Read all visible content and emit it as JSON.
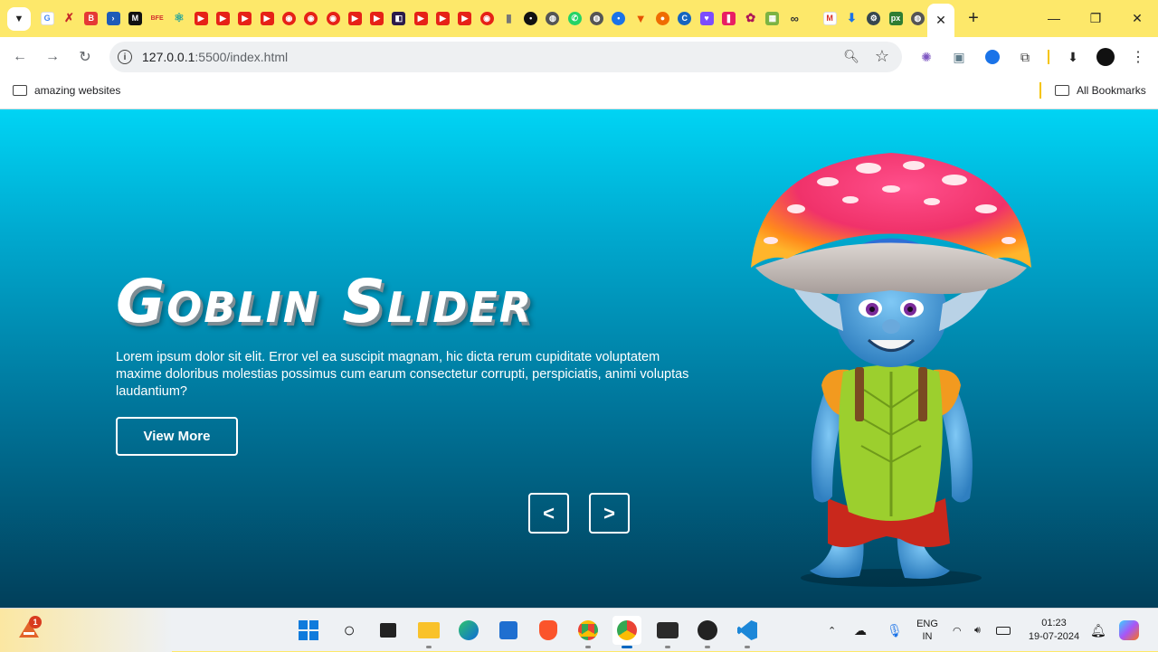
{
  "browser": {
    "url_host": "127.0.0.1",
    "url_path": ":5500/index.html",
    "close_tab": "✕",
    "new_tab": "+",
    "bookmarks": {
      "folder1": "amazing websites",
      "all": "All Bookmarks"
    },
    "pinned_labels": {
      "mono": "M",
      "bfe": "BFE",
      "px": "px"
    }
  },
  "hero": {
    "title": "Goblin Slider",
    "description": "Lorem ipsum dolor sit elit. Error vel ea suscipit magnam, hic dicta rerum cupiditate voluptatem maxime doloribus molestias possimus cum earum consectetur corrupti, perspiciatis, animi voluptas laudantium?",
    "cta_label": "View More",
    "prev_label": "<",
    "next_label": ">"
  },
  "taskbar": {
    "weather_badge": "1",
    "lang_line1": "ENG",
    "lang_line2": "IN",
    "time": "01:23",
    "date": "19-07-2024"
  },
  "colors": {
    "tab_strip": "#fde86a",
    "hero_gradient_top": "#00d4f4",
    "hero_gradient_bottom": "#013f5a",
    "accent": "#0067c0"
  }
}
